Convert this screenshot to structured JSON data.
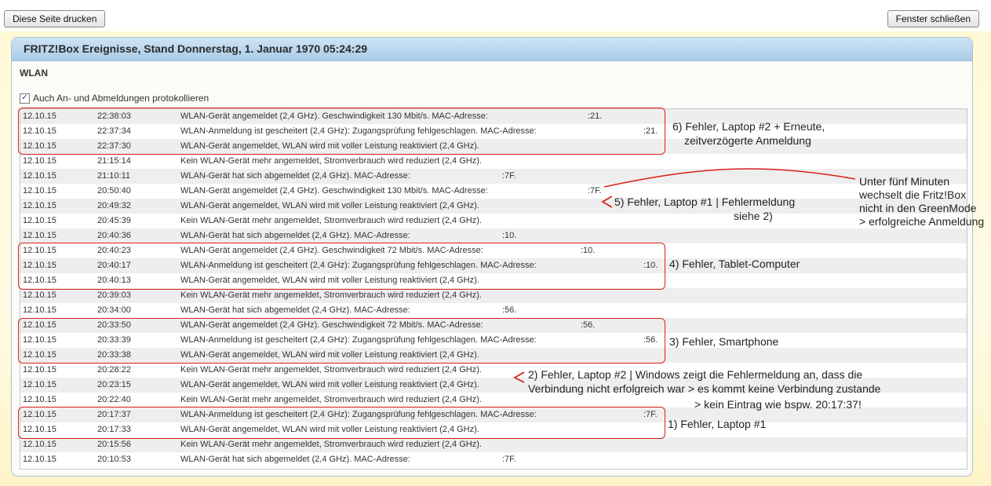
{
  "toolbar": {
    "print_label": "Diese Seite drucken",
    "close_label": "Fenster schließen"
  },
  "panel": {
    "title": "FRITZ!Box Ereignisse, Stand Donnerstag, 1. Januar 1970 05:24:29",
    "section": "WLAN",
    "checkbox_label": "Auch An- und Abmeldungen protokollieren",
    "checkbox_checked": true
  },
  "log": [
    {
      "date": "12.10.15",
      "time": "22:38:03",
      "msg": "WLAN-Gerät angemeldet (2,4 GHz). Geschwindigkeit 130 Mbit/s. MAC-Adresse:",
      "mac": ":21."
    },
    {
      "date": "12.10.15",
      "time": "22:37:34",
      "msg": "WLAN-Anmeldung ist gescheitert (2,4 GHz): Zugangsprüfung fehlgeschlagen. MAC-Adresse:",
      "mac": ":21."
    },
    {
      "date": "12.10.15",
      "time": "22:37:30",
      "msg": "WLAN-Gerät angemeldet, WLAN wird mit voller Leistung reaktiviert (2,4 GHz).",
      "mac": ""
    },
    {
      "date": "12.10.15",
      "time": "21:15:14",
      "msg": "Kein WLAN-Gerät mehr angemeldet, Stromverbrauch wird reduziert (2,4 GHz).",
      "mac": ""
    },
    {
      "date": "12.10.15",
      "time": "21:10:11",
      "msg": "WLAN-Gerät hat sich abgemeldet (2,4 GHz). MAC-Adresse:",
      "mac": ":7F."
    },
    {
      "date": "12.10.15",
      "time": "20:50:40",
      "msg": "WLAN-Gerät angemeldet (2,4 GHz). Geschwindigkeit 130 Mbit/s. MAC-Adresse:",
      "mac": ":7F."
    },
    {
      "date": "12.10.15",
      "time": "20:49:32",
      "msg": "WLAN-Gerät angemeldet, WLAN wird mit voller Leistung reaktiviert (2,4 GHz).",
      "mac": ""
    },
    {
      "date": "12.10.15",
      "time": "20:45:39",
      "msg": "Kein WLAN-Gerät mehr angemeldet, Stromverbrauch wird reduziert (2,4 GHz).",
      "mac": ""
    },
    {
      "date": "12.10.15",
      "time": "20:40:36",
      "msg": "WLAN-Gerät hat sich abgemeldet (2,4 GHz). MAC-Adresse:",
      "mac": ":10."
    },
    {
      "date": "12.10.15",
      "time": "20:40:23",
      "msg": "WLAN-Gerät angemeldet (2,4 GHz). Geschwindigkeit 72 Mbit/s. MAC-Adresse:",
      "mac": ":10."
    },
    {
      "date": "12.10.15",
      "time": "20:40:17",
      "msg": "WLAN-Anmeldung ist gescheitert (2,4 GHz): Zugangsprüfung fehlgeschlagen. MAC-Adresse:",
      "mac": ":10."
    },
    {
      "date": "12.10.15",
      "time": "20:40:13",
      "msg": "WLAN-Gerät angemeldet, WLAN wird mit voller Leistung reaktiviert (2,4 GHz).",
      "mac": ""
    },
    {
      "date": "12.10.15",
      "time": "20:39:03",
      "msg": "Kein WLAN-Gerät mehr angemeldet, Stromverbrauch wird reduziert (2,4 GHz).",
      "mac": ""
    },
    {
      "date": "12.10.15",
      "time": "20:34:00",
      "msg": "WLAN-Gerät hat sich abgemeldet (2,4 GHz). MAC-Adresse:",
      "mac": ":56."
    },
    {
      "date": "12.10.15",
      "time": "20:33:50",
      "msg": "WLAN-Gerät angemeldet (2,4 GHz). Geschwindigkeit 72 Mbit/s. MAC-Adresse:",
      "mac": ":56."
    },
    {
      "date": "12.10.15",
      "time": "20:33:39",
      "msg": "WLAN-Anmeldung ist gescheitert (2,4 GHz): Zugangsprüfung fehlgeschlagen. MAC-Adresse:",
      "mac": ":56."
    },
    {
      "date": "12.10.15",
      "time": "20:33:38",
      "msg": "WLAN-Gerät angemeldet, WLAN wird mit voller Leistung reaktiviert (2,4 GHz).",
      "mac": ""
    },
    {
      "date": "12.10.15",
      "time": "20:28:22",
      "msg": "Kein WLAN-Gerät mehr angemeldet, Stromverbrauch wird reduziert (2,4 GHz).",
      "mac": ""
    },
    {
      "date": "12.10.15",
      "time": "20:23:15",
      "msg": "WLAN-Gerät angemeldet, WLAN wird mit voller Leistung reaktiviert (2,4 GHz).",
      "mac": ""
    },
    {
      "date": "12.10.15",
      "time": "20:22:40",
      "msg": "Kein WLAN-Gerät mehr angemeldet, Stromverbrauch wird reduziert (2,4 GHz).",
      "mac": ""
    },
    {
      "date": "12.10.15",
      "time": "20:17:37",
      "msg": "WLAN-Anmeldung ist gescheitert (2,4 GHz): Zugangsprüfung fehlgeschlagen. MAC-Adresse:",
      "mac": ":7F."
    },
    {
      "date": "12.10.15",
      "time": "20:17:33",
      "msg": "WLAN-Gerät angemeldet, WLAN wird mit voller Leistung reaktiviert (2,4 GHz).",
      "mac": ""
    },
    {
      "date": "12.10.15",
      "time": "20:15:56",
      "msg": "Kein WLAN-Gerät mehr angemeldet, Stromverbrauch wird reduziert (2,4 GHz).",
      "mac": ""
    },
    {
      "date": "12.10.15",
      "time": "20:10:53",
      "msg": "WLAN-Gerät hat sich abgemeldet (2,4 GHz). MAC-Adresse:",
      "mac": ":7F."
    }
  ],
  "annotations": {
    "note6_line1": "6) Fehler, Laptop #2 + Erneute,",
    "note6_line2": "zeitverzögerte Anmeldung",
    "note5_line1": "5) Fehler, Laptop #1 | Fehlermeldung",
    "note5_line2": "siehe 2)",
    "note_green": "Unter fünf Minuten wechselt die Fritz!Box nicht in den GreenMode > erfolgreiche Anmeldung",
    "note4": "4) Fehler, Tablet-Computer",
    "note3": "3) Fehler, Smartphone",
    "note2_line1": "2) Fehler, Laptop #2 | Windows zeigt die Fehlermeldung an, dass die",
    "note2_line2": "Verbindung nicht erfolgreich war > es kommt keine Verbindung zustande",
    "note2_line3": "> kein Eintrag wie bspw. 20:17:37!",
    "note1": "1) Fehler, Laptop #1"
  },
  "colors": {
    "annotation_red": "#d9201b",
    "panel_header": "#a9cbe6",
    "row_alt": "#eeeeee"
  }
}
